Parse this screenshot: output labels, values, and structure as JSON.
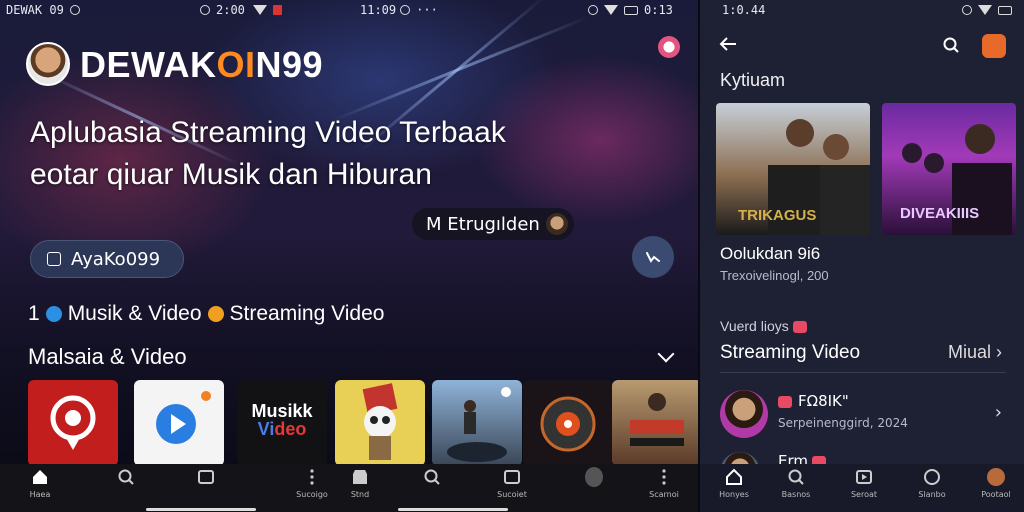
{
  "left": {
    "statusbar_a": {
      "time": "DEWAK 09"
    },
    "statusbar_b": {
      "time": "2:00"
    },
    "statusbar_c": {
      "time": "11:09",
      "extra": "···"
    },
    "statusbar_d": {
      "time": "0:13"
    },
    "brand": {
      "prefix": "DEWAK",
      "highlight": "OI",
      "suffix": "N99"
    },
    "hero_line1": "Aplubasia Streaming Video Terbaak",
    "hero_line2": "eotar qiuar Musik dan Hiburan",
    "chip_label": "M Etrugılden",
    "pill_button": "AyaKo099",
    "tags": {
      "prefix": "1",
      "tag1": "Musik & Video",
      "tag2": "Streaming Video"
    },
    "section_title": "Malsaia & Video",
    "tiles": [
      {
        "name": "pin-app",
        "label": ""
      },
      {
        "name": "play-app",
        "label": ""
      },
      {
        "name": "music-video-app",
        "label": "Musikk\nVideo"
      },
      {
        "name": "panda-app",
        "label": ""
      },
      {
        "name": "guitarist-app",
        "label": ""
      },
      {
        "name": "speaker-app",
        "label": ""
      },
      {
        "name": "band-app",
        "label": ""
      }
    ],
    "nav": [
      {
        "name": "home",
        "label": "Haea"
      },
      {
        "name": "search",
        "label": ""
      },
      {
        "name": "library",
        "label": ""
      },
      {
        "name": "more",
        "label": "Sucoigo"
      },
      {
        "name": "store",
        "label": "Stnd"
      },
      {
        "name": "search2",
        "label": ""
      },
      {
        "name": "library2",
        "label": "Sucoiet"
      },
      {
        "name": "profile",
        "label": ""
      },
      {
        "name": "more2",
        "label": "Scarnoi"
      }
    ]
  },
  "right": {
    "statusbar": {
      "time": "1:0.44"
    },
    "title": "Kytiuam",
    "card1_caption": "TRIKAGUS",
    "card2_caption": "DIVEAKIIIS",
    "now_title": "Oolukdan 9i6",
    "now_sub": "Trexoivelinogl, 200",
    "label_small": "Vuerd lioys",
    "section": "Streaming Video",
    "more": "Miual",
    "list": [
      {
        "title": "FΩ8IK\"",
        "sub": "Serpeinenggird, 2024"
      },
      {
        "title": "Erm",
        "sub": ""
      }
    ],
    "nav": [
      {
        "name": "home",
        "label": "Honyes"
      },
      {
        "name": "search",
        "label": "Basnos"
      },
      {
        "name": "library",
        "label": "Seroat"
      },
      {
        "name": "explore",
        "label": "Slanbo"
      },
      {
        "name": "profile",
        "label": "Pootaol"
      }
    ]
  },
  "colors": {
    "accent": "#ff8a1f",
    "panel": "#1e2033",
    "badge": "#e94a63"
  }
}
